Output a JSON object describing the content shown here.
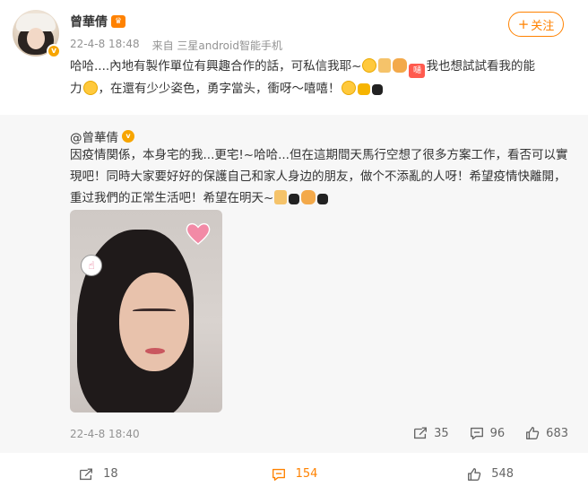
{
  "post": {
    "username": "曾華倩",
    "badge": "👑",
    "timestamp": "22-4-8 18:48",
    "source": "来自 三星android智能手机",
    "follow_label": "关注",
    "text_parts": [
      "哈哈....內地有製作單位有興趣合作的話，可私信我耶~",
      "我也想試試看我的能",
      "力",
      "，在還有少少姿色，勇字當头，衝呀～嘻嘻！"
    ],
    "tag_label": "嗵"
  },
  "repost": {
    "username": "@曾華倩",
    "text": "因疫情関係，本身宅的我...更宅!~哈哈...但在這期間天馬行空想了很多方案工作，看否可以實現吧！同時大家要好好的保護自己和家人身边的朋友，做个不添亂的人呀！希望疫情快離開，重过我們的正常生活吧！希望在明天~",
    "timestamp": "22-4-8 18:40",
    "actions": {
      "repost_count": "35",
      "comment_count": "96",
      "like_count": "683"
    }
  },
  "bottom_actions": {
    "repost_count": "18",
    "comment_count": "154",
    "like_count": "548"
  },
  "colors": {
    "accent": "#ff8200",
    "meta_gray": "#939393",
    "repost_bg": "#f7f7f7",
    "verified_gold": "#f7a500"
  }
}
